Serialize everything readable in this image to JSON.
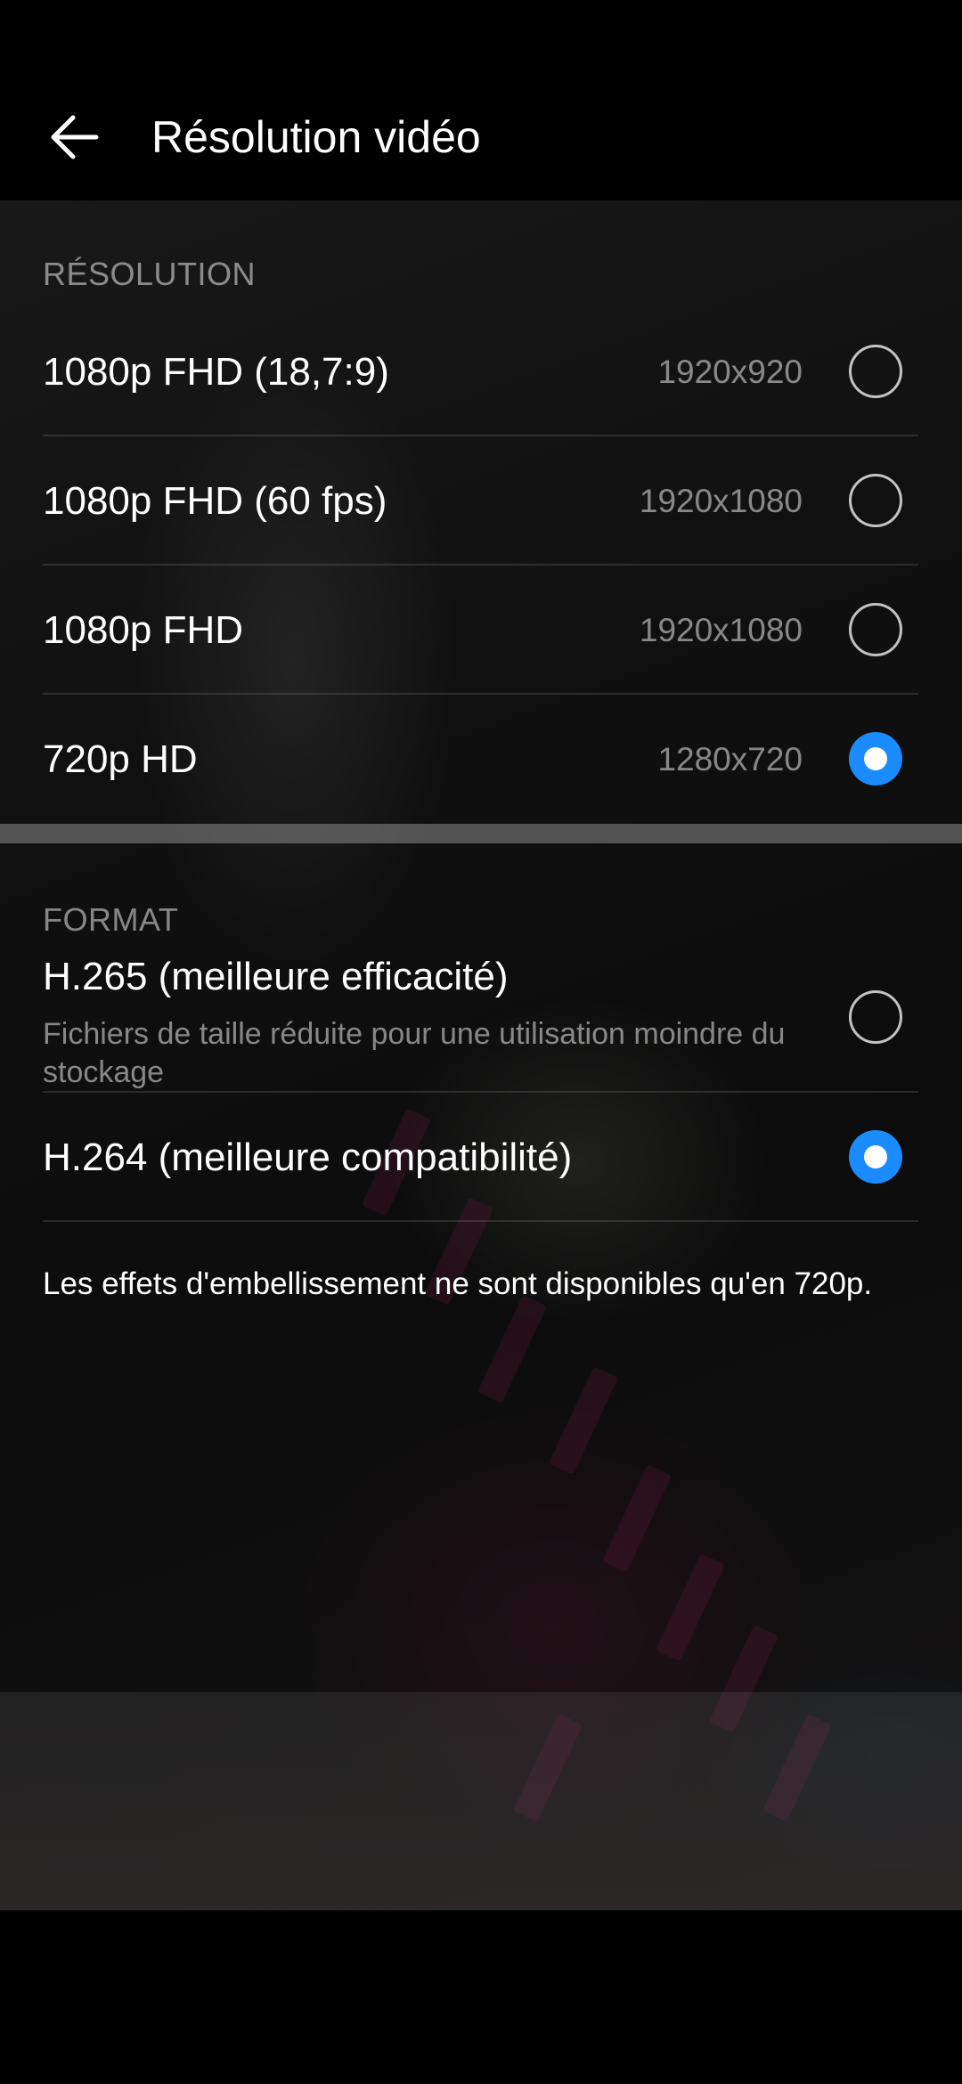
{
  "header": {
    "title": "Résolution vidéo",
    "back_icon": "arrow-left-icon"
  },
  "resolution": {
    "section_label": "RÉSOLUTION",
    "options": [
      {
        "label": "1080p FHD (18,7:9)",
        "value": "1920x920",
        "selected": false
      },
      {
        "label": "1080p FHD (60 fps)",
        "value": "1920x1080",
        "selected": false
      },
      {
        "label": "1080p FHD",
        "value": "1920x1080",
        "selected": false
      },
      {
        "label": "720p HD",
        "value": "1280x720",
        "selected": true
      }
    ]
  },
  "format": {
    "section_label": "FORMAT",
    "options": [
      {
        "label": "H.265 (meilleure efficacité)",
        "description": "Fichiers de taille réduite pour une utilisation moindre du stockage",
        "selected": false
      },
      {
        "label": "H.264 (meilleure compatibilité)",
        "selected": true
      }
    ]
  },
  "note": "Les effets d'embellissement ne sont disponibles qu'en 720p.",
  "colors": {
    "accent": "#1a8cff",
    "background": "#000000"
  }
}
